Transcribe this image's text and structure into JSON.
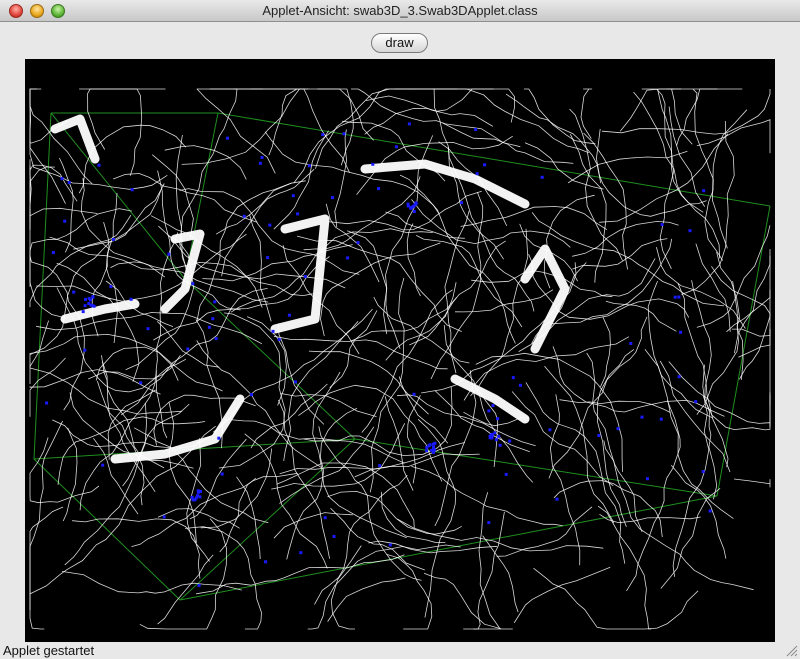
{
  "window": {
    "title": "Applet-Ansicht: swab3D_3.Swab3DApplet.class"
  },
  "toolbar": {
    "draw_label": "draw"
  },
  "status": {
    "text": "Applet gestartet"
  },
  "colors": {
    "canvas_bg": "#000000",
    "trail": "#ffffff",
    "agent": "#1a1aff",
    "box": "#1f8f1f"
  }
}
